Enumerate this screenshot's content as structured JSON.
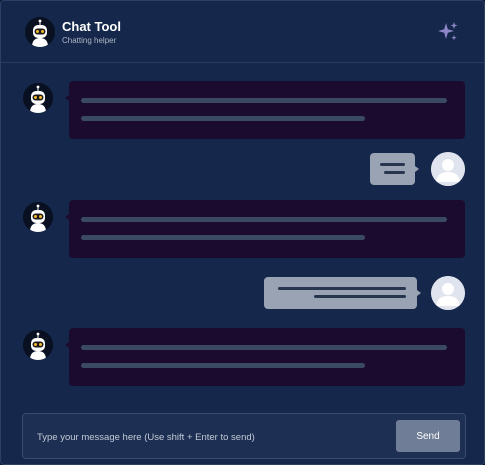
{
  "header": {
    "title": "Chat Tool",
    "subtitle": "Chatting helper",
    "action_icon": "sparkle-icon"
  },
  "colors": {
    "background": "#15274a",
    "bot_bubble": "#1b0c2f",
    "user_bubble": "#9aa3b3",
    "send_button": "#6f7d96",
    "sparkle": "#8e86c9"
  },
  "messages": [
    {
      "sender": "bot",
      "avatar_icon": "robot-icon"
    },
    {
      "sender": "user",
      "avatar_icon": "user-icon"
    },
    {
      "sender": "bot",
      "avatar_icon": "robot-icon"
    },
    {
      "sender": "user",
      "avatar_icon": "user-icon"
    },
    {
      "sender": "bot",
      "avatar_icon": "robot-icon"
    }
  ],
  "composer": {
    "placeholder": "Type your message here (Use shift + Enter to send)",
    "value": "",
    "send_label": "Send"
  }
}
